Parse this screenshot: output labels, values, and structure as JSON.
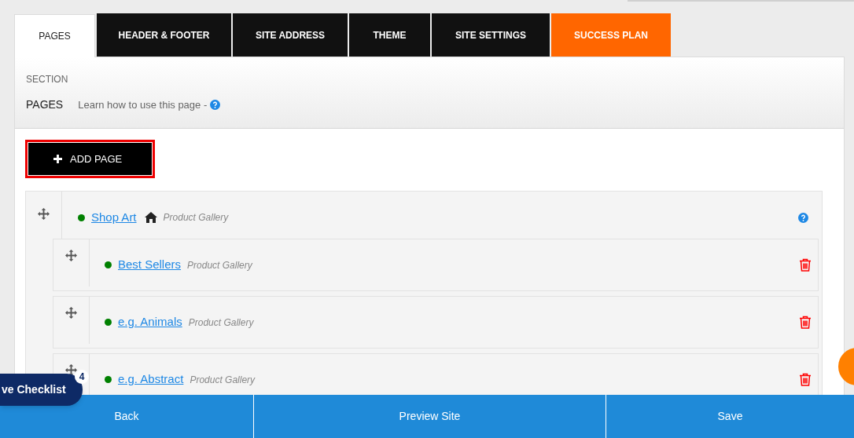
{
  "tabs": [
    {
      "label": "PAGES",
      "selected": true,
      "kind": "normal"
    },
    {
      "label": "HEADER & FOOTER",
      "selected": false,
      "kind": "normal"
    },
    {
      "label": "SITE ADDRESS",
      "selected": false,
      "kind": "normal"
    },
    {
      "label": "THEME",
      "selected": false,
      "kind": "normal"
    },
    {
      "label": "SITE SETTINGS",
      "selected": false,
      "kind": "normal"
    },
    {
      "label": "SUCCESS PLAN",
      "selected": false,
      "kind": "highlight"
    }
  ],
  "section": {
    "label": "SECTION",
    "title": "PAGES",
    "help_link": "Learn how to use this page -"
  },
  "add_page_button": {
    "label": "ADD PAGE"
  },
  "pages": [
    {
      "name": "Shop Art",
      "type": "Product Gallery",
      "published": true,
      "home": true,
      "children": [
        {
          "name": "Best Sellers",
          "type": "Product Gallery",
          "published": true,
          "home": false
        },
        {
          "name": "e.g. Animals",
          "type": "Product Gallery",
          "published": true,
          "home": false
        },
        {
          "name": "e.g. Abstract",
          "type": "Product Gallery",
          "published": true,
          "home": false
        }
      ]
    }
  ],
  "checklist": {
    "label": "ve Checklist",
    "count": "4"
  },
  "footer_buttons": [
    "Back",
    "Preview Site",
    "Save"
  ]
}
